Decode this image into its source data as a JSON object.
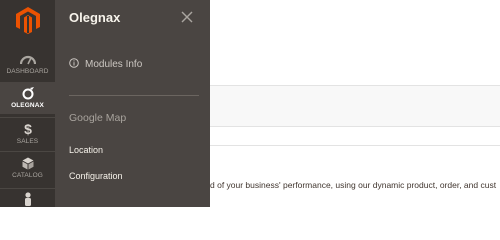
{
  "nav": {
    "items": [
      {
        "label": "DASHBOARD",
        "icon": "dashboard-icon"
      },
      {
        "label": "OLEGNAX",
        "icon": "olegnax-icon"
      },
      {
        "label": "SALES",
        "icon": "dollar-icon"
      },
      {
        "label": "CATALOG",
        "icon": "cube-icon"
      },
      {
        "label": "",
        "icon": "customer-icon"
      }
    ]
  },
  "flyout": {
    "title": "Olegnax",
    "modules_info": "Modules Info",
    "group_title": "Google Map",
    "links": [
      "Location",
      "Configuration"
    ]
  },
  "content": {
    "text": "d of your business' performance, using our dynamic product, order, and cust"
  },
  "colors": {
    "brand": "#eb5202",
    "nav_bg": "#373330",
    "flyout_bg": "#4a4542"
  }
}
